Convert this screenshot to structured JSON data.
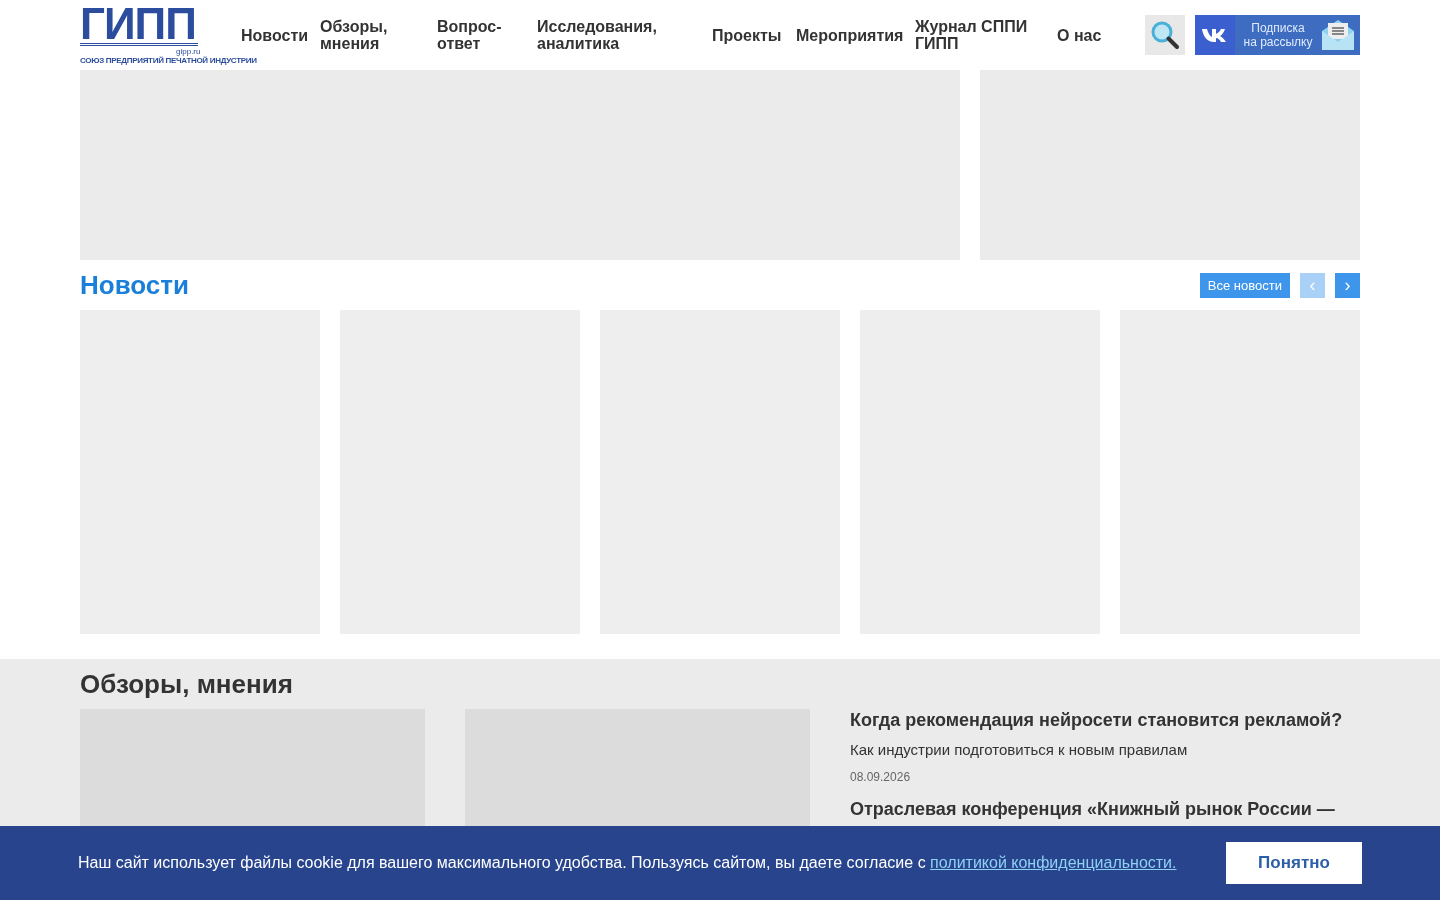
{
  "header": {
    "logo": {
      "wordmark": "ГИПП",
      "domain": "gipp.ru",
      "caption": "СОЮЗ ПРЕДПРИЯТИЙ ПЕЧАТНОЙ ИНДУСТРИИ"
    },
    "nav": [
      {
        "label": "Новости"
      },
      {
        "label": "Обзоры, мнения"
      },
      {
        "label": "Вопрос-ответ"
      },
      {
        "label": "Исследования, аналитика"
      },
      {
        "label": "Проекты"
      },
      {
        "label": "Мероприятия"
      },
      {
        "label": "Журнал СППИ ГИПП"
      },
      {
        "label": "О нас"
      }
    ],
    "subscribe": {
      "line1": "Подписка",
      "line2": "на рассылку"
    }
  },
  "banners": [
    {
      "kind": "wide"
    },
    {
      "kind": "narrow"
    }
  ],
  "news": {
    "title": "Новости",
    "all_button": "Все новости",
    "prev": {
      "label": "‹",
      "disabled": true
    },
    "next": {
      "label": "›",
      "disabled": false
    }
  },
  "reviews": {
    "title": "Обзоры, мнения",
    "articles": [
      {
        "headline": "Когда рекомендация нейросети становится рекламой?",
        "subtitle": "Как индустрии подготовиться к новым правилам",
        "date": "08.09.2026"
      },
      {
        "headline": "Отраслевая конференция «Книжный рынок России —"
      }
    ]
  },
  "cookie": {
    "text": "Наш сайт использует файлы cookie для вашего максимального удобства. Пользуясь сайтом, вы даете согласие с",
    "link": "политикой конфиденциальности.",
    "button": "Понятно"
  }
}
